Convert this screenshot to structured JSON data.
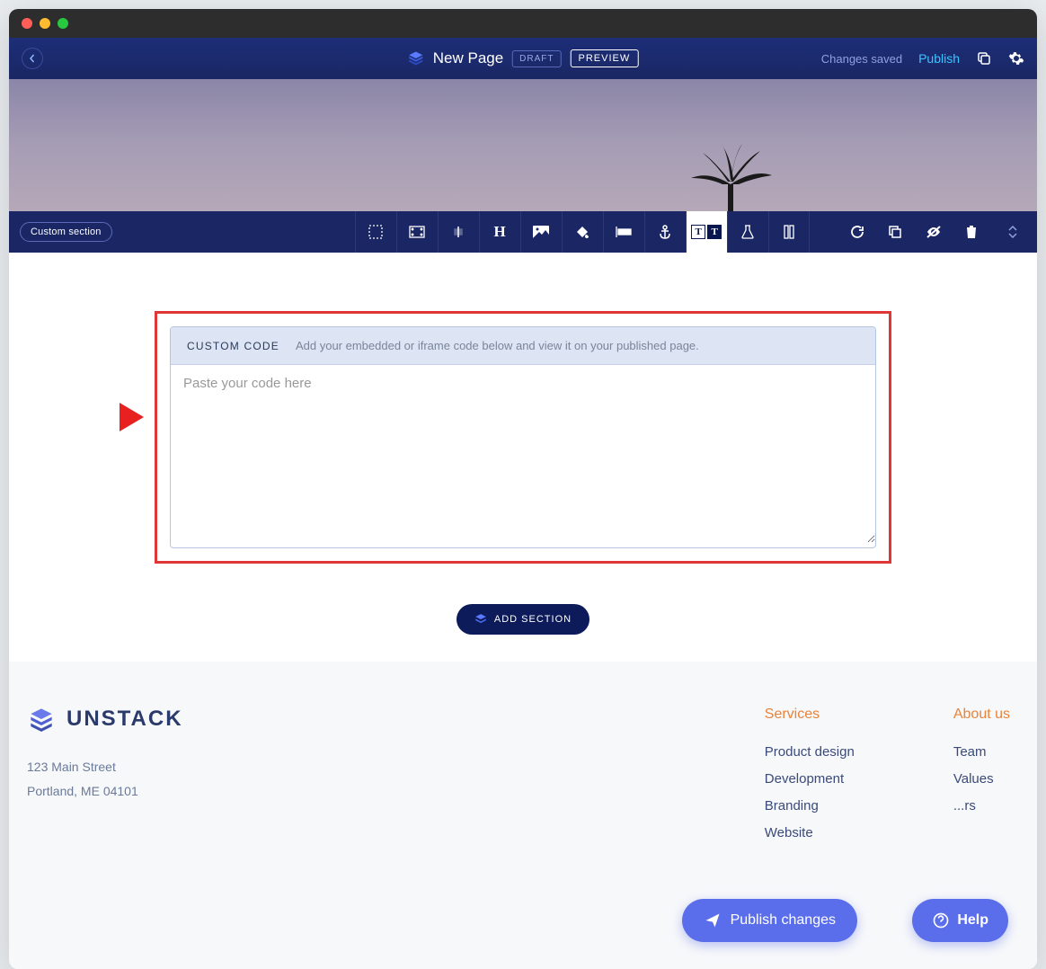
{
  "header": {
    "page_title": "New Page",
    "draft_badge": "DRAFT",
    "preview_badge": "PREVIEW",
    "saved_text": "Changes saved",
    "publish_link": "Publish"
  },
  "toolbar": {
    "section_chip": "Custom section"
  },
  "custom_code": {
    "title": "CUSTOM CODE",
    "description": "Add your embedded or iframe code below and view it on your published page.",
    "placeholder": "Paste your code here"
  },
  "add_section_label": "ADD SECTION",
  "footer": {
    "brand": "UNSTACK",
    "address_line1": "123 Main Street",
    "address_line2": "Portland, ME 04101",
    "cols": [
      {
        "title": "Services",
        "links": [
          "Product design",
          "Development",
          "Branding",
          "Website"
        ]
      },
      {
        "title": "About us",
        "links": [
          "Team",
          "Values",
          "...rs"
        ]
      }
    ]
  },
  "floating": {
    "publish": "Publish changes",
    "help": "Help"
  }
}
